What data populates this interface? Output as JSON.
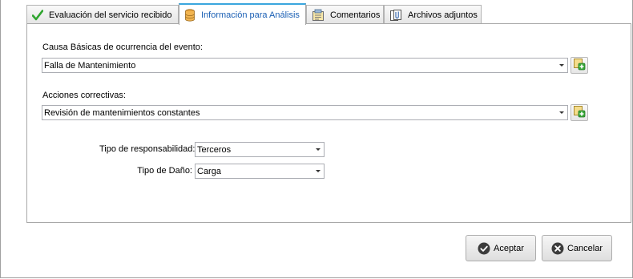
{
  "tabs": [
    {
      "label": "Evaluación del servicio recibido",
      "icon": "checkmark-icon",
      "active": false
    },
    {
      "label": "Información para Análisis",
      "icon": "database-icon",
      "active": true
    },
    {
      "label": "Comentarios",
      "icon": "note-icon",
      "active": false
    },
    {
      "label": "Archivos adjuntos",
      "icon": "attachment-icon",
      "active": false
    }
  ],
  "form": {
    "causa_label": "Causa Básicas de ocurrencia del evento:",
    "causa_value": "Falla de Mantenimiento",
    "acciones_label": "Acciones correctivas:",
    "acciones_value": "Revisión de mantenimientos constantes",
    "responsabilidad_label": "Tipo de responsabilidad:",
    "responsabilidad_value": "Terceros",
    "dano_label": "Tipo de Daño:",
    "dano_value": "Carga"
  },
  "buttons": {
    "accept_label": "Aceptar",
    "cancel_label": "Cancelar"
  },
  "colors": {
    "active_tab_accent": "#3aa6de",
    "accept_icon": "#3c3c3c",
    "cancel_icon": "#3c3c3c",
    "add_icon_green": "#3aa83a"
  }
}
